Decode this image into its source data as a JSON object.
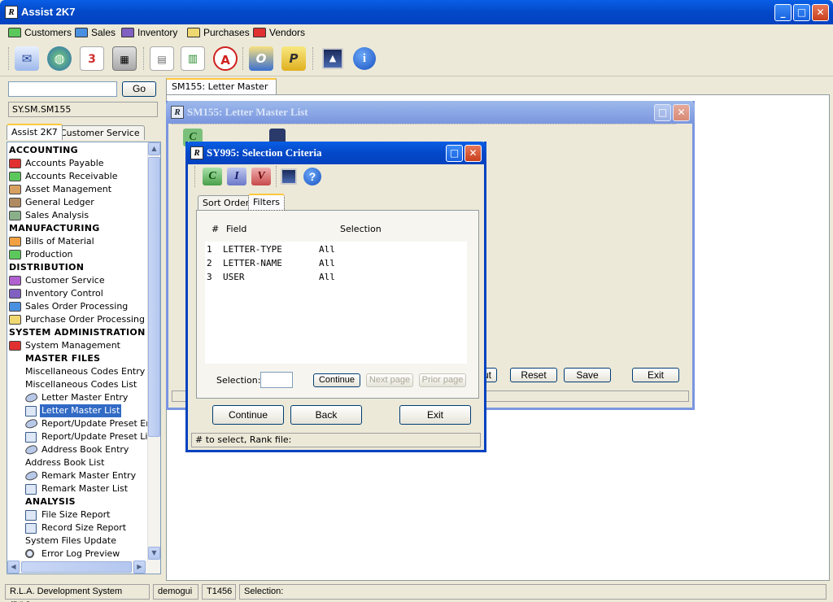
{
  "app": {
    "title": "Assist 2K7"
  },
  "menu": [
    "Customers",
    "Sales",
    "Inventory",
    "Purchases",
    "Vendors"
  ],
  "menu_colors": [
    "#5cc85c",
    "#4a90e0",
    "#8060c0",
    "#f0d870",
    "#e03030"
  ],
  "toolbar_icons": [
    "mail-icon",
    "globe-icon",
    "calendar-icon",
    "calculator-icon",
    "notepad-icon",
    "spreadsheet-icon",
    "pdf-icon",
    "outlook-icon",
    "publisher-icon",
    "image-icon",
    "info-icon"
  ],
  "left": {
    "go_label": "Go",
    "search_value": "",
    "path": "SY.SM.SM155",
    "tabs": [
      "Assist 2K7",
      "Customer Service"
    ],
    "tree": [
      {
        "type": "head",
        "label": "ACCOUNTING"
      },
      {
        "type": "folder",
        "color": "#e03030",
        "label": "Accounts Payable"
      },
      {
        "type": "folder",
        "color": "#5cc85c",
        "label": "Accounts Receivable"
      },
      {
        "type": "folder",
        "color": "#d8a060",
        "label": "Asset Management"
      },
      {
        "type": "folder",
        "color": "#b08a60",
        "label": "General Ledger"
      },
      {
        "type": "folder",
        "color": "#8ab08a",
        "label": "Sales Analysis"
      },
      {
        "type": "head",
        "label": "MANUFACTURING"
      },
      {
        "type": "folder",
        "color": "#f0a040",
        "label": "Bills of Material"
      },
      {
        "type": "folder",
        "color": "#5cc85c",
        "label": "Production"
      },
      {
        "type": "head",
        "label": "DISTRIBUTION"
      },
      {
        "type": "folder",
        "color": "#b060d0",
        "label": "Customer Service"
      },
      {
        "type": "folder",
        "color": "#8060c0",
        "label": "Inventory Control"
      },
      {
        "type": "folder",
        "color": "#4a90e0",
        "label": "Sales Order Processing"
      },
      {
        "type": "folder",
        "color": "#f0d870",
        "label": "Purchase Order Processing"
      },
      {
        "type": "head",
        "label": "SYSTEM ADMINISTRATION"
      },
      {
        "type": "folder",
        "color": "#e03030",
        "label": "System Management"
      },
      {
        "type": "subhead",
        "label": "MASTER FILES"
      },
      {
        "type": "plain",
        "label": "Miscellaneous Codes Entry"
      },
      {
        "type": "plain",
        "label": "Miscellaneous Codes List"
      },
      {
        "type": "edit",
        "label": "Letter Master Entry"
      },
      {
        "type": "doc",
        "label": "Letter Master List",
        "selected": true
      },
      {
        "type": "edit",
        "label": "Report/Update Preset Entr"
      },
      {
        "type": "doc",
        "label": "Report/Update Preset List"
      },
      {
        "type": "edit",
        "label": "Address Book Entry"
      },
      {
        "type": "plain",
        "label": "Address Book List"
      },
      {
        "type": "edit",
        "label": "Remark Master Entry"
      },
      {
        "type": "doc",
        "label": "Remark Master List"
      },
      {
        "type": "subhead",
        "label": "ANALYSIS"
      },
      {
        "type": "doc",
        "label": "File Size Report"
      },
      {
        "type": "doc",
        "label": "Record Size Report"
      },
      {
        "type": "plain",
        "label": "System Files Update"
      },
      {
        "type": "mag",
        "label": "Error Log Preview"
      }
    ]
  },
  "workspace_tab": "SM155: Letter Master List",
  "sm155": {
    "title": "SM155: Letter Master List",
    "buttons": [
      "ut",
      "Reset",
      "Save",
      "Exit"
    ]
  },
  "sy995": {
    "title": "SY995: Selection Criteria",
    "tabs": [
      "Sort Order",
      "Filters"
    ],
    "headers": {
      "num": "#",
      "field": "Field",
      "selection": "Selection"
    },
    "rows": [
      {
        "num": "1",
        "field": "LETTER-TYPE",
        "selection": "All"
      },
      {
        "num": "2",
        "field": "LETTER-NAME",
        "selection": "All"
      },
      {
        "num": "3",
        "field": "USER",
        "selection": "All"
      }
    ],
    "selection_label": "Selection:",
    "selection_value": "",
    "continue_small": "Continue",
    "next_page": "Next page",
    "prior_page": "Prior page",
    "continue": "Continue",
    "back": "Back",
    "exit": "Exit",
    "status": "# to select,  Rank file:"
  },
  "statusbar": {
    "system": "R.L.A. Development System (DIV)",
    "user": "demogui",
    "terminal": "T1456",
    "selection": "Selection:"
  }
}
